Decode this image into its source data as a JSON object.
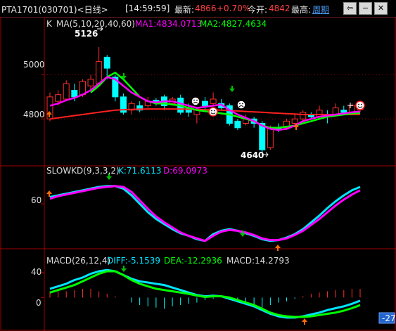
{
  "topbar": {
    "symbol": "PTA1701(030701)<日线>",
    "time": "[14:59:59]",
    "latest_label": "最新:",
    "latest_value": "4866",
    "change_pct": "+0.70%",
    "open_label": "今开:",
    "open_value": "4842",
    "high_label": "最高:",
    "period_link": "周期",
    "btn_back": "⇦",
    "btn_min": "−",
    "btn_close": "✕"
  },
  "colors": {
    "price_up": "#ff4040",
    "ma1": "#ff00ff",
    "ma2": "#00ff00",
    "ma40": "#ff2020",
    "k_line": "#00e5ff",
    "d_line": "#ff00ff",
    "diff": "#00e5ff",
    "dea": "#00ff00"
  },
  "panels": {
    "kline": {
      "title": "K",
      "ma_label": "MA(5,10,20,40,60)",
      "ma1_label": "MA1:4834.0713",
      "ma2_label": "MA2:4827.4634",
      "y_ticks": [
        "5000",
        "4800"
      ],
      "high_annotation": "5126",
      "low_annotation": "4640"
    },
    "slowkd": {
      "title": "SLOWKD(9,3,3,2)",
      "k_label": "K:71.6113",
      "d_label": "D:69.0973",
      "y_ticks": [
        "60"
      ]
    },
    "macd": {
      "title": "MACD(26,12,4)",
      "diff_label": "DIFF:-5.1539",
      "dea_label": "DEA:-12.2936",
      "macd_label": "MACD:14.2793",
      "y_ticks": [
        "40",
        "0"
      ],
      "corner_value": "-27"
    }
  },
  "chart_data": [
    {
      "type": "candlestick",
      "title": "K",
      "ylim": [
        4600,
        5180
      ],
      "y_ticks": [
        5000,
        4800
      ],
      "candles": [
        {
          "o": 4800,
          "c": 4900,
          "h": 4920,
          "l": 4790
        },
        {
          "o": 4880,
          "c": 4910,
          "h": 4930,
          "l": 4860
        },
        {
          "o": 4890,
          "c": 4960,
          "h": 4975,
          "l": 4880
        },
        {
          "o": 4930,
          "c": 4900,
          "h": 4960,
          "l": 4880
        },
        {
          "o": 4910,
          "c": 4970,
          "h": 4980,
          "l": 4900
        },
        {
          "o": 4950,
          "c": 4980,
          "h": 5000,
          "l": 4930
        },
        {
          "o": 4960,
          "c": 5060,
          "h": 5126,
          "l": 4950
        },
        {
          "o": 5080,
          "c": 5030,
          "h": 5090,
          "l": 4980
        },
        {
          "o": 4990,
          "c": 4900,
          "h": 5000,
          "l": 4880
        },
        {
          "o": 4900,
          "c": 4830,
          "h": 4915,
          "l": 4820
        },
        {
          "o": 4840,
          "c": 4870,
          "h": 4880,
          "l": 4820
        },
        {
          "o": 4860,
          "c": 4840,
          "h": 4880,
          "l": 4830
        },
        {
          "o": 4860,
          "c": 4880,
          "h": 4900,
          "l": 4850
        },
        {
          "o": 4885,
          "c": 4880,
          "h": 4895,
          "l": 4860
        },
        {
          "o": 4900,
          "c": 4860,
          "h": 4910,
          "l": 4840
        },
        {
          "o": 4870,
          "c": 4890,
          "h": 4900,
          "l": 4860
        },
        {
          "o": 4895,
          "c": 4830,
          "h": 4910,
          "l": 4820
        },
        {
          "o": 4850,
          "c": 4830,
          "h": 4870,
          "l": 4810
        },
        {
          "o": 4820,
          "c": 4840,
          "h": 4850,
          "l": 4780
        },
        {
          "o": 4880,
          "c": 4860,
          "h": 4900,
          "l": 4840
        },
        {
          "o": 4870,
          "c": 4890,
          "h": 4920,
          "l": 4860
        },
        {
          "o": 4870,
          "c": 4850,
          "h": 4890,
          "l": 4840
        },
        {
          "o": 4860,
          "c": 4780,
          "h": 4870,
          "l": 4770
        },
        {
          "o": 4790,
          "c": 4760,
          "h": 4800,
          "l": 4750
        },
        {
          "o": 4780,
          "c": 4800,
          "h": 4820,
          "l": 4770
        },
        {
          "o": 4800,
          "c": 4780,
          "h": 4810,
          "l": 4760
        },
        {
          "o": 4780,
          "c": 4660,
          "h": 4790,
          "l": 4640
        },
        {
          "o": 4670,
          "c": 4760,
          "h": 4770,
          "l": 4660
        },
        {
          "o": 4760,
          "c": 4750,
          "h": 4780,
          "l": 4740
        },
        {
          "o": 4760,
          "c": 4790,
          "h": 4800,
          "l": 4750
        },
        {
          "o": 4780,
          "c": 4800,
          "h": 4820,
          "l": 4770
        },
        {
          "o": 4800,
          "c": 4830,
          "h": 4840,
          "l": 4790
        },
        {
          "o": 4820,
          "c": 4810,
          "h": 4830,
          "l": 4800
        },
        {
          "o": 4810,
          "c": 4840,
          "h": 4860,
          "l": 4800
        },
        {
          "o": 4820,
          "c": 4810,
          "h": 4840,
          "l": 4780
        },
        {
          "o": 4820,
          "c": 4850,
          "h": 4870,
          "l": 4810
        },
        {
          "o": 4840,
          "c": 4830,
          "h": 4860,
          "l": 4820
        },
        {
          "o": 4830,
          "c": 4860,
          "h": 4870,
          "l": 4820
        },
        {
          "o": 4842,
          "c": 4866,
          "h": 4880,
          "l": 4830
        }
      ],
      "series": [
        {
          "name": "MA1",
          "values": [
            4860,
            4870,
            4885,
            4895,
            4910,
            4930,
            4960,
            4990,
            4980,
            4950,
            4920,
            4900,
            4880,
            4875,
            4880,
            4880,
            4870,
            4860,
            4850,
            4855,
            4860,
            4865,
            4840,
            4820,
            4805,
            4790,
            4770,
            4755,
            4750,
            4755,
            4770,
            4790,
            4800,
            4810,
            4815,
            4820,
            4825,
            4830,
            4834
          ]
        },
        {
          "name": "MA2",
          "values": [
            null,
            null,
            null,
            null,
            null,
            4920,
            4950,
            4990,
            5010,
            4980,
            4940,
            4900,
            4880,
            4870,
            4870,
            4865,
            4860,
            4850,
            4840,
            4835,
            4830,
            4825,
            4820,
            4810,
            4800,
            4790,
            4770,
            4760,
            4760,
            4765,
            4770,
            4780,
            4790,
            4800,
            4810,
            4815,
            4820,
            4825,
            4827
          ]
        },
        {
          "name": "MA40",
          "values": [
            4800,
            4805,
            4810,
            4815,
            4820,
            4825,
            4830,
            4835,
            4840,
            4842,
            4843,
            4844,
            4845,
            4845,
            4845,
            4845,
            4845,
            4844,
            4843,
            4842,
            4841,
            4840,
            4838,
            4836,
            4834,
            4832,
            4830,
            4828,
            4826,
            4824,
            4822,
            4820,
            4820,
            4820,
            4820,
            4820,
            4820,
            4820,
            4820
          ]
        }
      ]
    },
    {
      "type": "line",
      "title": "SLOWKD(9,3,3,2)",
      "ylim": [
        10,
        90
      ],
      "y_ticks": [
        60
      ],
      "series": [
        {
          "name": "K",
          "values": [
            68,
            70,
            72,
            74,
            76,
            78,
            80,
            81,
            81,
            78,
            70,
            60,
            50,
            42,
            36,
            30,
            25,
            22,
            18,
            16,
            24,
            28,
            30,
            28,
            25,
            22,
            18,
            16,
            17,
            20,
            24,
            30,
            38,
            46,
            55,
            63,
            70,
            76,
            80
          ]
        },
        {
          "name": "D",
          "values": [
            66,
            69,
            71,
            73,
            75,
            77,
            79,
            80,
            81,
            80,
            74,
            64,
            54,
            45,
            38,
            32,
            26,
            22,
            19,
            16,
            22,
            27,
            29,
            28,
            26,
            23,
            19,
            17,
            17,
            19,
            23,
            28,
            35,
            42,
            50,
            58,
            65,
            71,
            76
          ]
        }
      ]
    },
    {
      "type": "line",
      "title": "MACD(26,12,4)",
      "ylim": [
        -40,
        60
      ],
      "y_ticks": [
        40,
        0
      ],
      "series": [
        {
          "name": "DIFF",
          "values": [
            14,
            18,
            22,
            28,
            32,
            38,
            42,
            44,
            42,
            36,
            30,
            26,
            24,
            22,
            20,
            16,
            12,
            8,
            4,
            2,
            3,
            2,
            -2,
            -6,
            -10,
            -14,
            -20,
            -26,
            -30,
            -32,
            -32,
            -30,
            -27,
            -24,
            -20,
            -17,
            -14,
            -10,
            -5
          ]
        },
        {
          "name": "DEA",
          "values": [
            8,
            12,
            16,
            20,
            26,
            32,
            38,
            42,
            42,
            36,
            28,
            22,
            18,
            14,
            12,
            10,
            8,
            6,
            3,
            1,
            2,
            2,
            0,
            -4,
            -8,
            -12,
            -18,
            -24,
            -28,
            -30,
            -31,
            -31,
            -30,
            -28,
            -26,
            -24,
            -21,
            -17,
            -12
          ]
        },
        {
          "name": "MACD",
          "values": [
            10,
            10,
            10,
            12,
            14,
            14,
            10,
            6,
            2,
            0,
            -8,
            -12,
            -14,
            -16,
            -18,
            -14,
            -12,
            -10,
            -8,
            -4,
            -2,
            0,
            -4,
            -8,
            -10,
            -12,
            -16,
            -12,
            -8,
            -6,
            -2,
            2,
            6,
            8,
            10,
            12,
            12,
            14,
            14
          ]
        }
      ]
    }
  ]
}
